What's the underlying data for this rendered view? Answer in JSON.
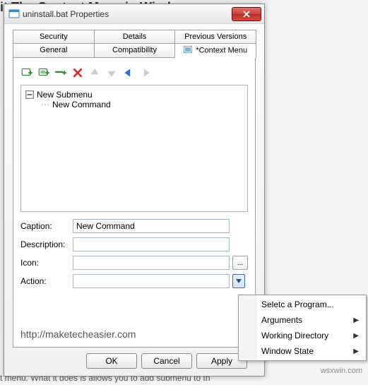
{
  "backdrop": {
    "top_text": "it The Context Menu in Windows",
    "bottom_text": "t menu. What it does is allows you to add submenu to th"
  },
  "window": {
    "title": "uninstall.bat Properties"
  },
  "tabs": {
    "row1": [
      "Security",
      "Details",
      "Previous Versions"
    ],
    "row2": [
      "General",
      "Compatibility",
      "*Context Menu"
    ],
    "active": "*Context Menu"
  },
  "tree": {
    "root": "New Submenu",
    "child": "New Command"
  },
  "fields": {
    "caption_label": "Caption:",
    "caption_value": "New Command",
    "description_label": "Description:",
    "description_value": "",
    "icon_label": "Icon:",
    "icon_value": "",
    "action_label": "Action:",
    "action_value": ""
  },
  "browse_label": "...",
  "watermark": "http://maketecheasier.com",
  "buttons": {
    "ok": "OK",
    "cancel": "Cancel",
    "apply": "Apply"
  },
  "menu": {
    "items": [
      {
        "label": "Seletc a Program...",
        "sub": false
      },
      {
        "label": "Arguments",
        "sub": true
      },
      {
        "label": "Working Directory",
        "sub": true
      },
      {
        "label": "Window State",
        "sub": true
      }
    ]
  },
  "source": "wsxwin.com"
}
